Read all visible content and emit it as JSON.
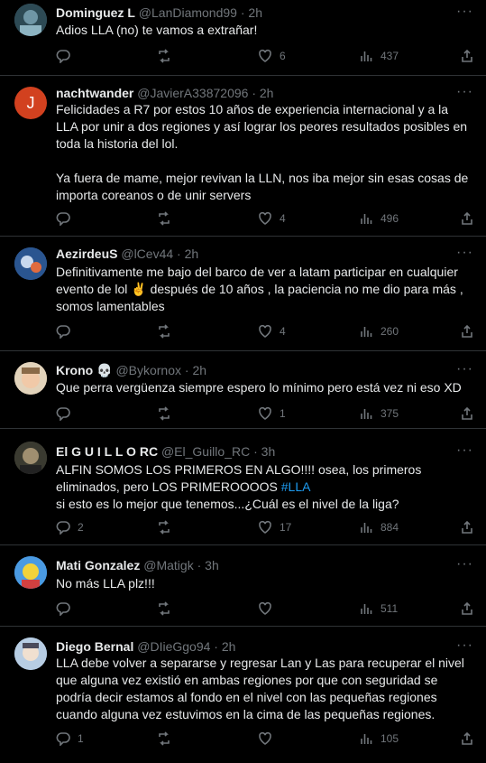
{
  "tweets": [
    {
      "name": "Dominguez L",
      "handle": "@LanDiamond99",
      "time": "2h",
      "body": [
        "Adios LLA (no) te vamos a extrañar!"
      ],
      "replies": "",
      "retweets": "",
      "likes": "6",
      "views": "437",
      "avatar_color": "#4a6a7a"
    },
    {
      "name": "nachtwander",
      "handle": "@JavierA33872096",
      "time": "2h",
      "body": [
        "Felicidades a R7 por estos 10 años de experiencia internacional y a la LLA por unir a dos regiones y así lograr los peores resultados posibles en toda la historia del lol.",
        "Ya fuera de mame, mejor revivan la LLN, nos iba mejor sin esas cosas de importa coreanos o de unir servers"
      ],
      "replies": "",
      "retweets": "",
      "likes": "4",
      "views": "496",
      "avatar_letter": "J",
      "avatar_color": "#d2411f"
    },
    {
      "name": "AezirdeuS",
      "handle": "@lCev44",
      "time": "2h",
      "body": [
        "Definitivamente me bajo del barco de ver a latam participar en cualquier evento de lol ✌️ después de 10 años , la paciencia no me dio para más , somos lamentables"
      ],
      "replies": "",
      "retweets": "",
      "likes": "4",
      "views": "260",
      "avatar_color": "#3a6fb0"
    },
    {
      "name": "Krono 💀",
      "handle": "@Bykornox",
      "time": "2h",
      "body": [
        "Que perra vergüenza siempre espero lo mínimo pero está vez ni eso XD"
      ],
      "replies": "",
      "retweets": "",
      "likes": "1",
      "views": "375",
      "avatar_color": "#d9c6a8"
    },
    {
      "name": "El G U I L L O RC",
      "handle": "@El_Guillo_RC",
      "time": "3h",
      "body_pre": "ALFIN SOMOS LOS PRIMEROS EN ALGO!!!! osea, los primeros eliminados, pero LOS PRIMEROOOOS ",
      "body_tag": "#LLA",
      "body_post": "si esto es lo mejor que tenemos...¿Cuál es el nivel de la liga?",
      "replies": "2",
      "retweets": "",
      "likes": "17",
      "views": "884",
      "avatar_color": "#5a5a4a"
    },
    {
      "name": "Mati Gonzalez",
      "handle": "@Matigk",
      "time": "3h",
      "body": [
        "No más LLA plz!!!"
      ],
      "replies": "",
      "retweets": "",
      "likes": "",
      "views": "511",
      "avatar_color": "#3f8fd8"
    },
    {
      "name": "Diego Bernal",
      "handle": "@DIieGgo94",
      "time": "2h",
      "body": [
        "LLA debe volver a separarse y regresar Lan y Las para recuperar el nivel que alguna vez existió en ambas regiones por que con seguridad se podría decir estamos al fondo en el nivel con las pequeñas regiones cuando alguna vez estuvimos en la cima de las pequeñas regiones."
      ],
      "replies": "1",
      "retweets": "",
      "likes": "",
      "views": "105",
      "avatar_color": "#8fb0d0"
    }
  ]
}
